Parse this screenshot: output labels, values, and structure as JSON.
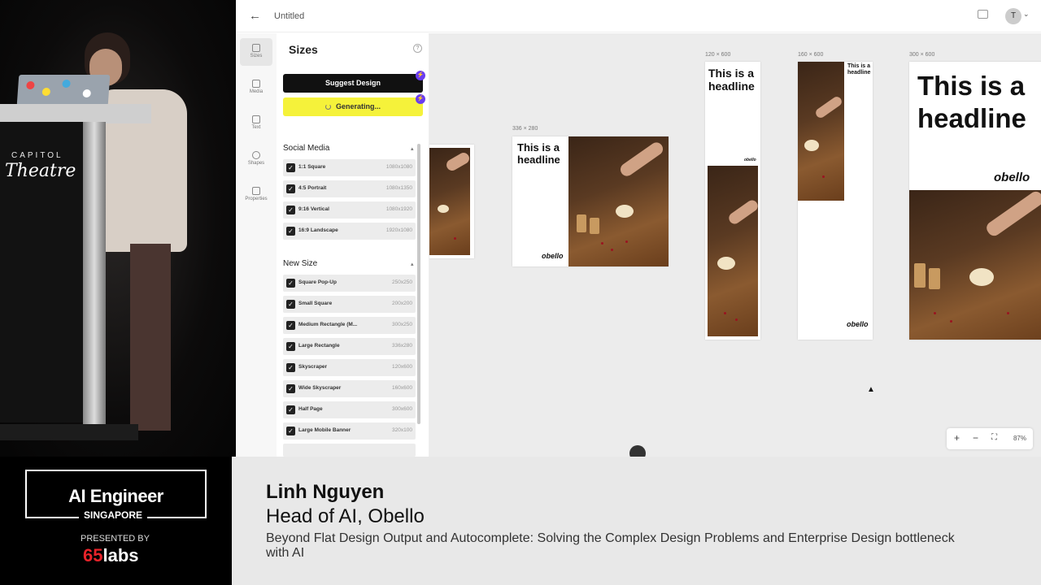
{
  "stage": {
    "venue_small": "CAPITOL",
    "venue_big": "Theatre"
  },
  "app": {
    "title": "Untitled",
    "avatar_initial": "T",
    "rail": [
      {
        "label": "Sizes",
        "icon": "layout-icon"
      },
      {
        "label": "Media",
        "icon": "image-icon"
      },
      {
        "label": "Text",
        "icon": "text-icon"
      },
      {
        "label": "Shapes",
        "icon": "shapes-icon"
      },
      {
        "label": "Properties",
        "icon": "properties-icon"
      }
    ],
    "panel": {
      "title": "Sizes",
      "suggest_label": "Suggest Design",
      "generating_label": "Generating...",
      "social_title": "Social Media",
      "social": [
        {
          "name": "1:1 Square",
          "size": "1080x1080"
        },
        {
          "name": "4:5 Portrait",
          "size": "1080x1350"
        },
        {
          "name": "9:16 Vertical",
          "size": "1080x1920"
        },
        {
          "name": "16:9 Landscape",
          "size": "1920x1080"
        }
      ],
      "new_title": "New Size",
      "new": [
        {
          "name": "Square Pop-Up",
          "size": "250x250"
        },
        {
          "name": "Small Square",
          "size": "200x200"
        },
        {
          "name": "Medium Rectangle (M...",
          "size": "300x250"
        },
        {
          "name": "Large Rectangle",
          "size": "336x280"
        },
        {
          "name": "Skyscraper",
          "size": "120x600"
        },
        {
          "name": "Wide Skyscraper",
          "size": "160x600"
        },
        {
          "name": "Half Page",
          "size": "300x600"
        },
        {
          "name": "Large Mobile Banner",
          "size": "320x100"
        }
      ]
    },
    "canvas": {
      "frames": [
        {
          "dim": "336 × 280",
          "headline": "This is a headline",
          "logo": "obello"
        },
        {
          "dim": "120 × 600",
          "headline": "This is a headline",
          "logo": "obello"
        },
        {
          "dim": "160 × 600",
          "headline": "This is a headline",
          "logo": "obello"
        },
        {
          "dim": "300 × 600",
          "headline": "This is a headline",
          "logo": "obello"
        }
      ],
      "zoom": "87%"
    }
  },
  "overlay": {
    "brand_line1": "AI Engineer",
    "brand_line2": "SINGAPORE",
    "presented_by": "PRESENTED BY",
    "sponsor_num": "65",
    "sponsor_word": "labs",
    "speaker": "Linh Nguyen",
    "role": "Head of AI, Obello",
    "talk": "Beyond Flat Design Output and Autocomplete: Solving the Complex Design Problems and Enterprise Design bottleneck with AI"
  }
}
